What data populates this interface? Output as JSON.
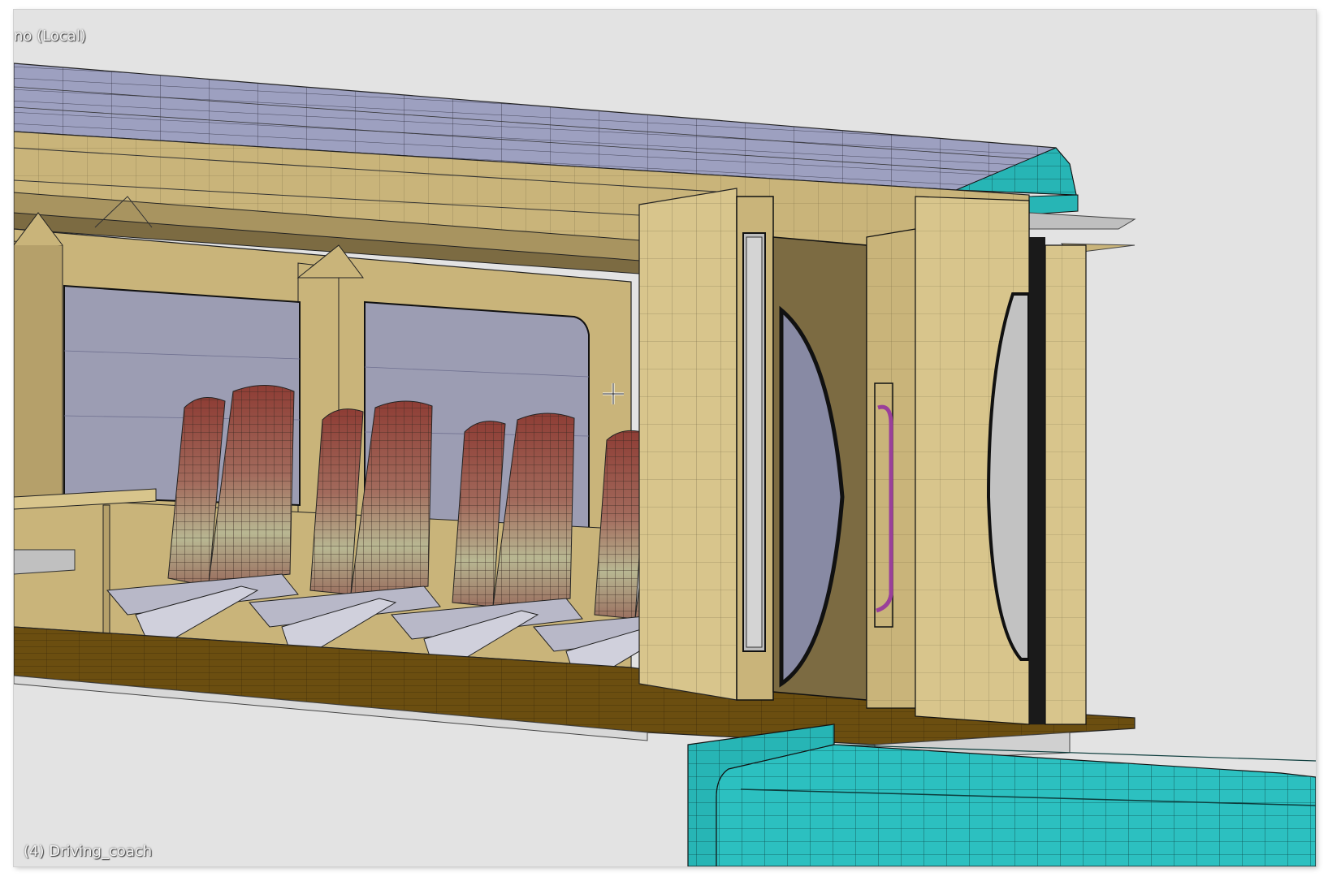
{
  "viewport": {
    "view_label": "no (Local)",
    "object_label": "(4) Driving_coach"
  },
  "colors": {
    "background": "#e3e3e3",
    "roof": "#9da0c0",
    "wall": "#c9b47a",
    "wall_shadow": "#7c6b42",
    "floor": "#6b4e10",
    "window": "#9c9db3",
    "seat_top": "#8e4a40",
    "seat_bottom": "#b7b791",
    "teal": "#28b8b8",
    "door_panel": "#bdbdbd",
    "handrail": "#9a3f9a"
  },
  "icons": {
    "cursor": "crosshair-cursor-icon"
  }
}
